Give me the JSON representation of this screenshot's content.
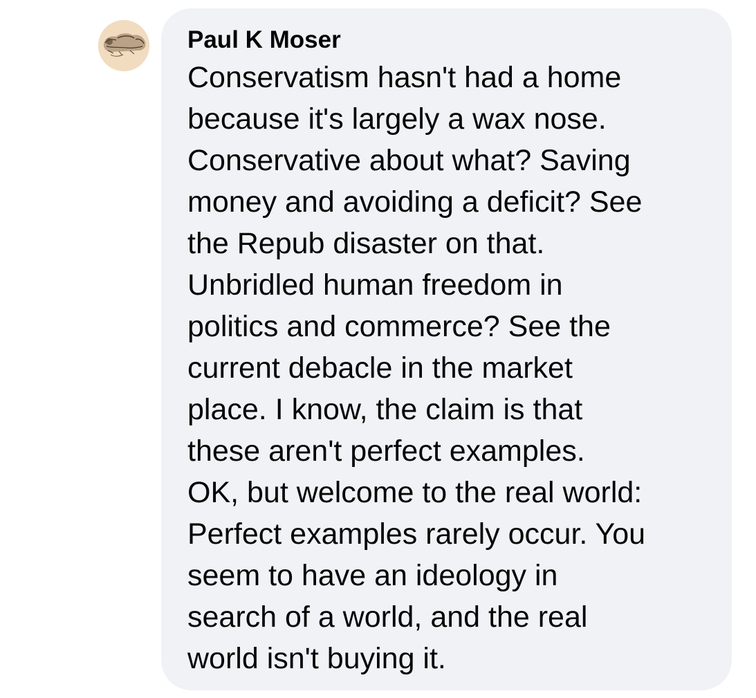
{
  "comment": {
    "author": "Paul K Moser",
    "lines": [
      "Conservatism hasn't had a home",
      "because it's largely a wax nose.",
      "Conservative about what? Saving",
      "money and avoiding a deficit? See",
      "the Repub disaster on that.",
      "Unbridled human freedom in",
      "politics and commerce? See the",
      "current debacle in the market",
      "place. I know, the claim is that",
      "these aren't perfect examples.",
      "OK, but welcome to the real world:",
      "Perfect examples rarely occur. You",
      "seem to have an ideology in",
      "search of a world, and the real",
      "world isn't buying it."
    ]
  },
  "colors": {
    "bubble_background": "#f0f2f5",
    "text": "#050505",
    "avatar_background": "#f1dcc0"
  },
  "icons": {
    "avatar": "profile-avatar-lion-drawing"
  }
}
